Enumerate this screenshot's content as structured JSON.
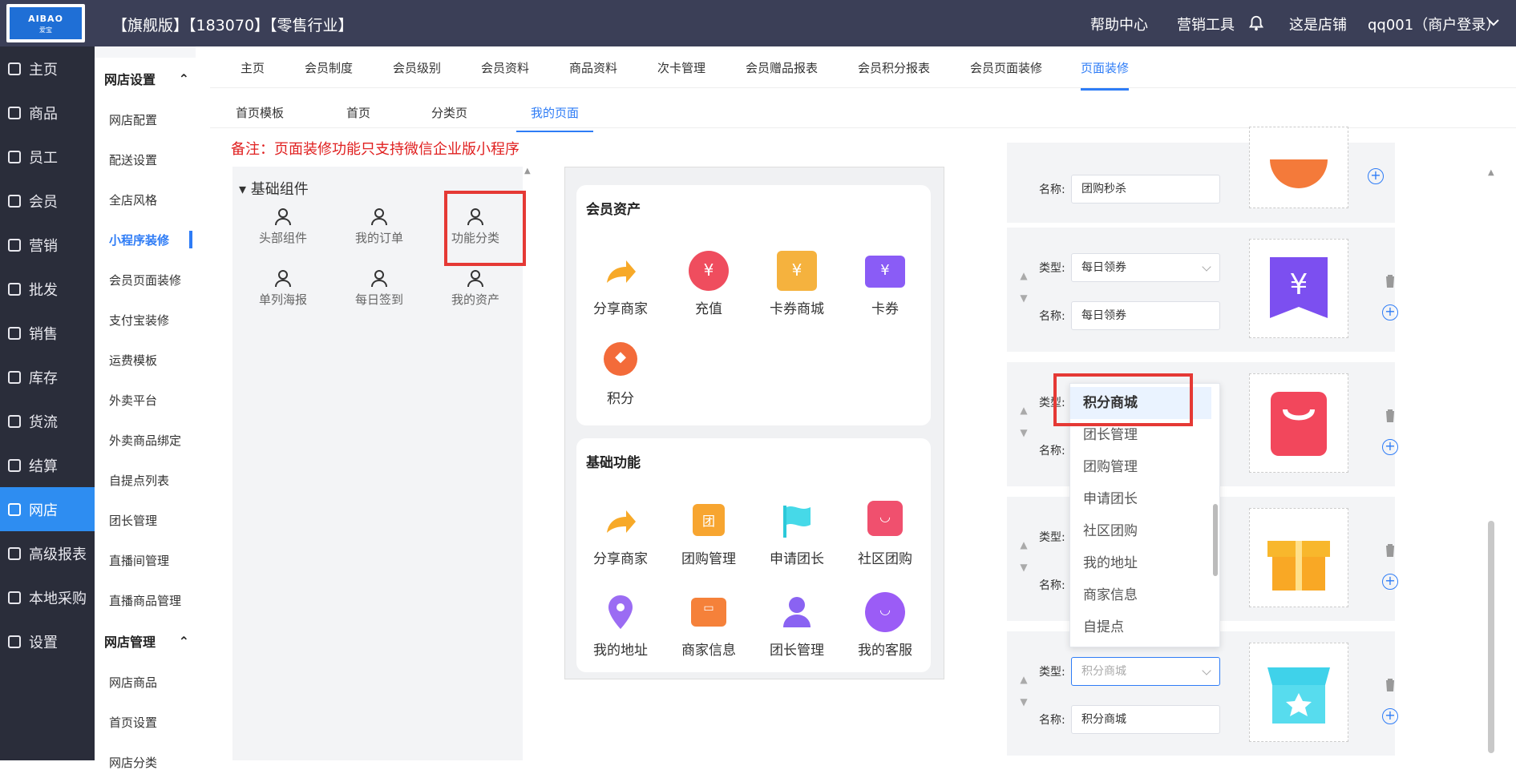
{
  "header": {
    "logo_text": "AIBAO",
    "logo_sub": "爱宝",
    "title": "【旗舰版】【183070】【零售行业】",
    "nav": [
      "帮助中心",
      "营销工具",
      "这是店铺",
      "qq001（商户登录）"
    ]
  },
  "leftnav": [
    {
      "label": "主页"
    },
    {
      "label": "商品"
    },
    {
      "label": "员工"
    },
    {
      "label": "会员"
    },
    {
      "label": "营销"
    },
    {
      "label": "批发"
    },
    {
      "label": "销售"
    },
    {
      "label": "库存"
    },
    {
      "label": "货流"
    },
    {
      "label": "结算"
    },
    {
      "label": "网店",
      "active": true
    },
    {
      "label": "高级报表"
    },
    {
      "label": "本地采购"
    },
    {
      "label": "设置"
    }
  ],
  "subnav": {
    "group1": "网店设置",
    "items1": [
      "网店配置",
      "配送设置",
      "全店风格",
      "小程序装修",
      "会员页面装修",
      "支付宝装修",
      "运费模板",
      "外卖平台",
      "外卖商品绑定",
      "自提点列表",
      "团长管理",
      "直播间管理",
      "直播商品管理"
    ],
    "group2": "网店管理",
    "items2": [
      "网店商品",
      "首页设置",
      "网店分类"
    ]
  },
  "main_tabs": [
    "主页",
    "会员制度",
    "会员级别",
    "会员资料",
    "商品资料",
    "次卡管理",
    "会员赠品报表",
    "会员积分报表",
    "会员页面装修",
    "页面装修"
  ],
  "sub_tabs": [
    "首页模板",
    "首页",
    "分类页",
    "我的页面"
  ],
  "note": "备注：页面装修功能只支持微信企业版小程序",
  "components": {
    "group": "基础组件",
    "items": [
      "头部组件",
      "我的订单",
      "功能分类",
      "单列海报",
      "每日签到",
      "我的资产"
    ]
  },
  "phone": {
    "card1": {
      "title": "会员资产",
      "items": [
        "分享商家",
        "充值",
        "卡券商城",
        "卡券",
        "积分"
      ]
    },
    "card2": {
      "title": "基础功能",
      "items": [
        "分享商家",
        "团购管理",
        "申请团长",
        "社区团购",
        "我的地址",
        "商家信息",
        "团长管理",
        "我的客服"
      ]
    }
  },
  "right": {
    "type_label": "类型:",
    "name_label": "名称:",
    "rows": [
      {
        "type": "",
        "name": "团购秒杀"
      },
      {
        "type": "每日领券",
        "name": "每日领券"
      },
      {
        "type": "",
        "name": ""
      },
      {
        "type": "",
        "name": ""
      },
      {
        "type": "积分商城",
        "name": "积分商城"
      }
    ],
    "dropdown": [
      "积分商城",
      "团长管理",
      "团购管理",
      "申请团长",
      "社区团购",
      "我的地址",
      "商家信息",
      "自提点"
    ]
  },
  "colors": {
    "accent": "#2e7cf6",
    "sidebar": "#2a2d3a",
    "topbar": "#3b3f57",
    "highlight": "#e53935"
  }
}
